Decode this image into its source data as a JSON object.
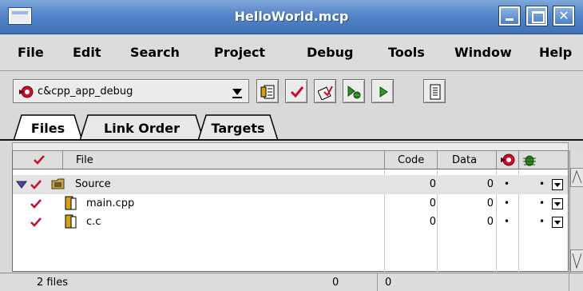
{
  "window": {
    "title": "HelloWorld.mcp"
  },
  "menu": [
    "File",
    "Edit",
    "Search",
    "Project",
    "Debug",
    "Tools",
    "Window",
    "Help"
  ],
  "toolbar": {
    "target_value": "c&cpp_app_debug",
    "buttons": [
      "settings-icon",
      "checkmark-icon",
      "make-icon",
      "debug-icon",
      "run-icon",
      "file-list-icon"
    ]
  },
  "tabs": [
    {
      "label": "Files",
      "active": true
    },
    {
      "label": "Link Order",
      "active": false
    },
    {
      "label": "Targets",
      "active": false
    }
  ],
  "table": {
    "headers": {
      "file": "File",
      "code": "Code",
      "data": "Data"
    },
    "rows": [
      {
        "name": "Source",
        "code": "0",
        "data": "0",
        "type": "group"
      },
      {
        "name": "main.cpp",
        "code": "0",
        "data": "0",
        "type": "file"
      },
      {
        "name": "c.c",
        "code": "0",
        "data": "0",
        "type": "file"
      }
    ]
  },
  "status": {
    "files": "2 files",
    "code_total": "0",
    "data_total": "0"
  },
  "colors": {
    "titlebar": "#4f80c4",
    "check": "#c8102e",
    "target_icon": "#c8102e",
    "debug_bug": "#2e8b1f"
  }
}
